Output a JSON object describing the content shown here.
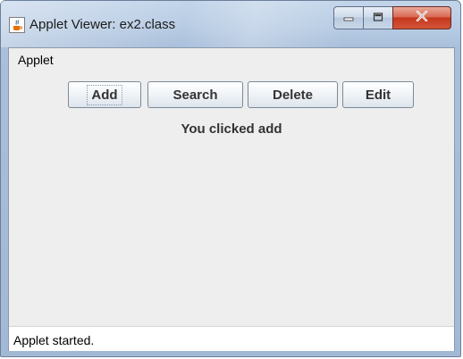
{
  "window": {
    "title": "Applet Viewer: ex2.class",
    "icon": "java-cup-icon"
  },
  "caption_buttons": {
    "minimize_icon": "minimize-icon",
    "maximize_icon": "maximize-icon",
    "close_icon": "close-icon"
  },
  "menubar": {
    "items": [
      {
        "label": "Applet"
      }
    ]
  },
  "applet": {
    "buttons": [
      {
        "label": "Add",
        "focused": true
      },
      {
        "label": "Search"
      },
      {
        "label": "Delete"
      },
      {
        "label": "Edit"
      }
    ],
    "message": "You clicked add"
  },
  "statusbar": {
    "text": "Applet started."
  },
  "colors": {
    "titlebar": "#b7cbe3",
    "close_button": "#c5371d",
    "panel": "#eeeeee"
  }
}
